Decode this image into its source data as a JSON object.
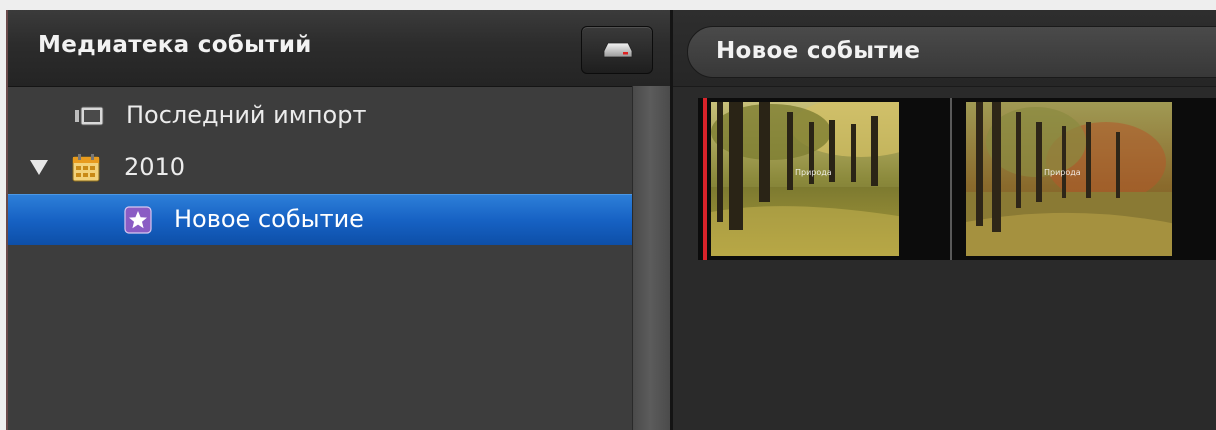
{
  "library": {
    "title": "Медиатека событий",
    "eject_icon": "drive-eject-icon",
    "items": [
      {
        "label": "Последний импорт",
        "icon": "last-import-icon"
      },
      {
        "label": "2010",
        "icon": "calendar-icon",
        "expanded": true
      },
      {
        "label": "Новое событие",
        "icon": "star-event-icon",
        "selected": true
      }
    ]
  },
  "browser": {
    "event_title": "Новое событие",
    "clips": [
      {
        "caption": "Природа",
        "icon": "clip-thumbnail"
      },
      {
        "caption": "Природа",
        "icon": "clip-thumbnail"
      }
    ]
  },
  "colors": {
    "selection": "#1762c4",
    "playhead": "#d8232a",
    "panel_bg": "#3d3d3d",
    "dark_bg": "#2a2a2a"
  }
}
